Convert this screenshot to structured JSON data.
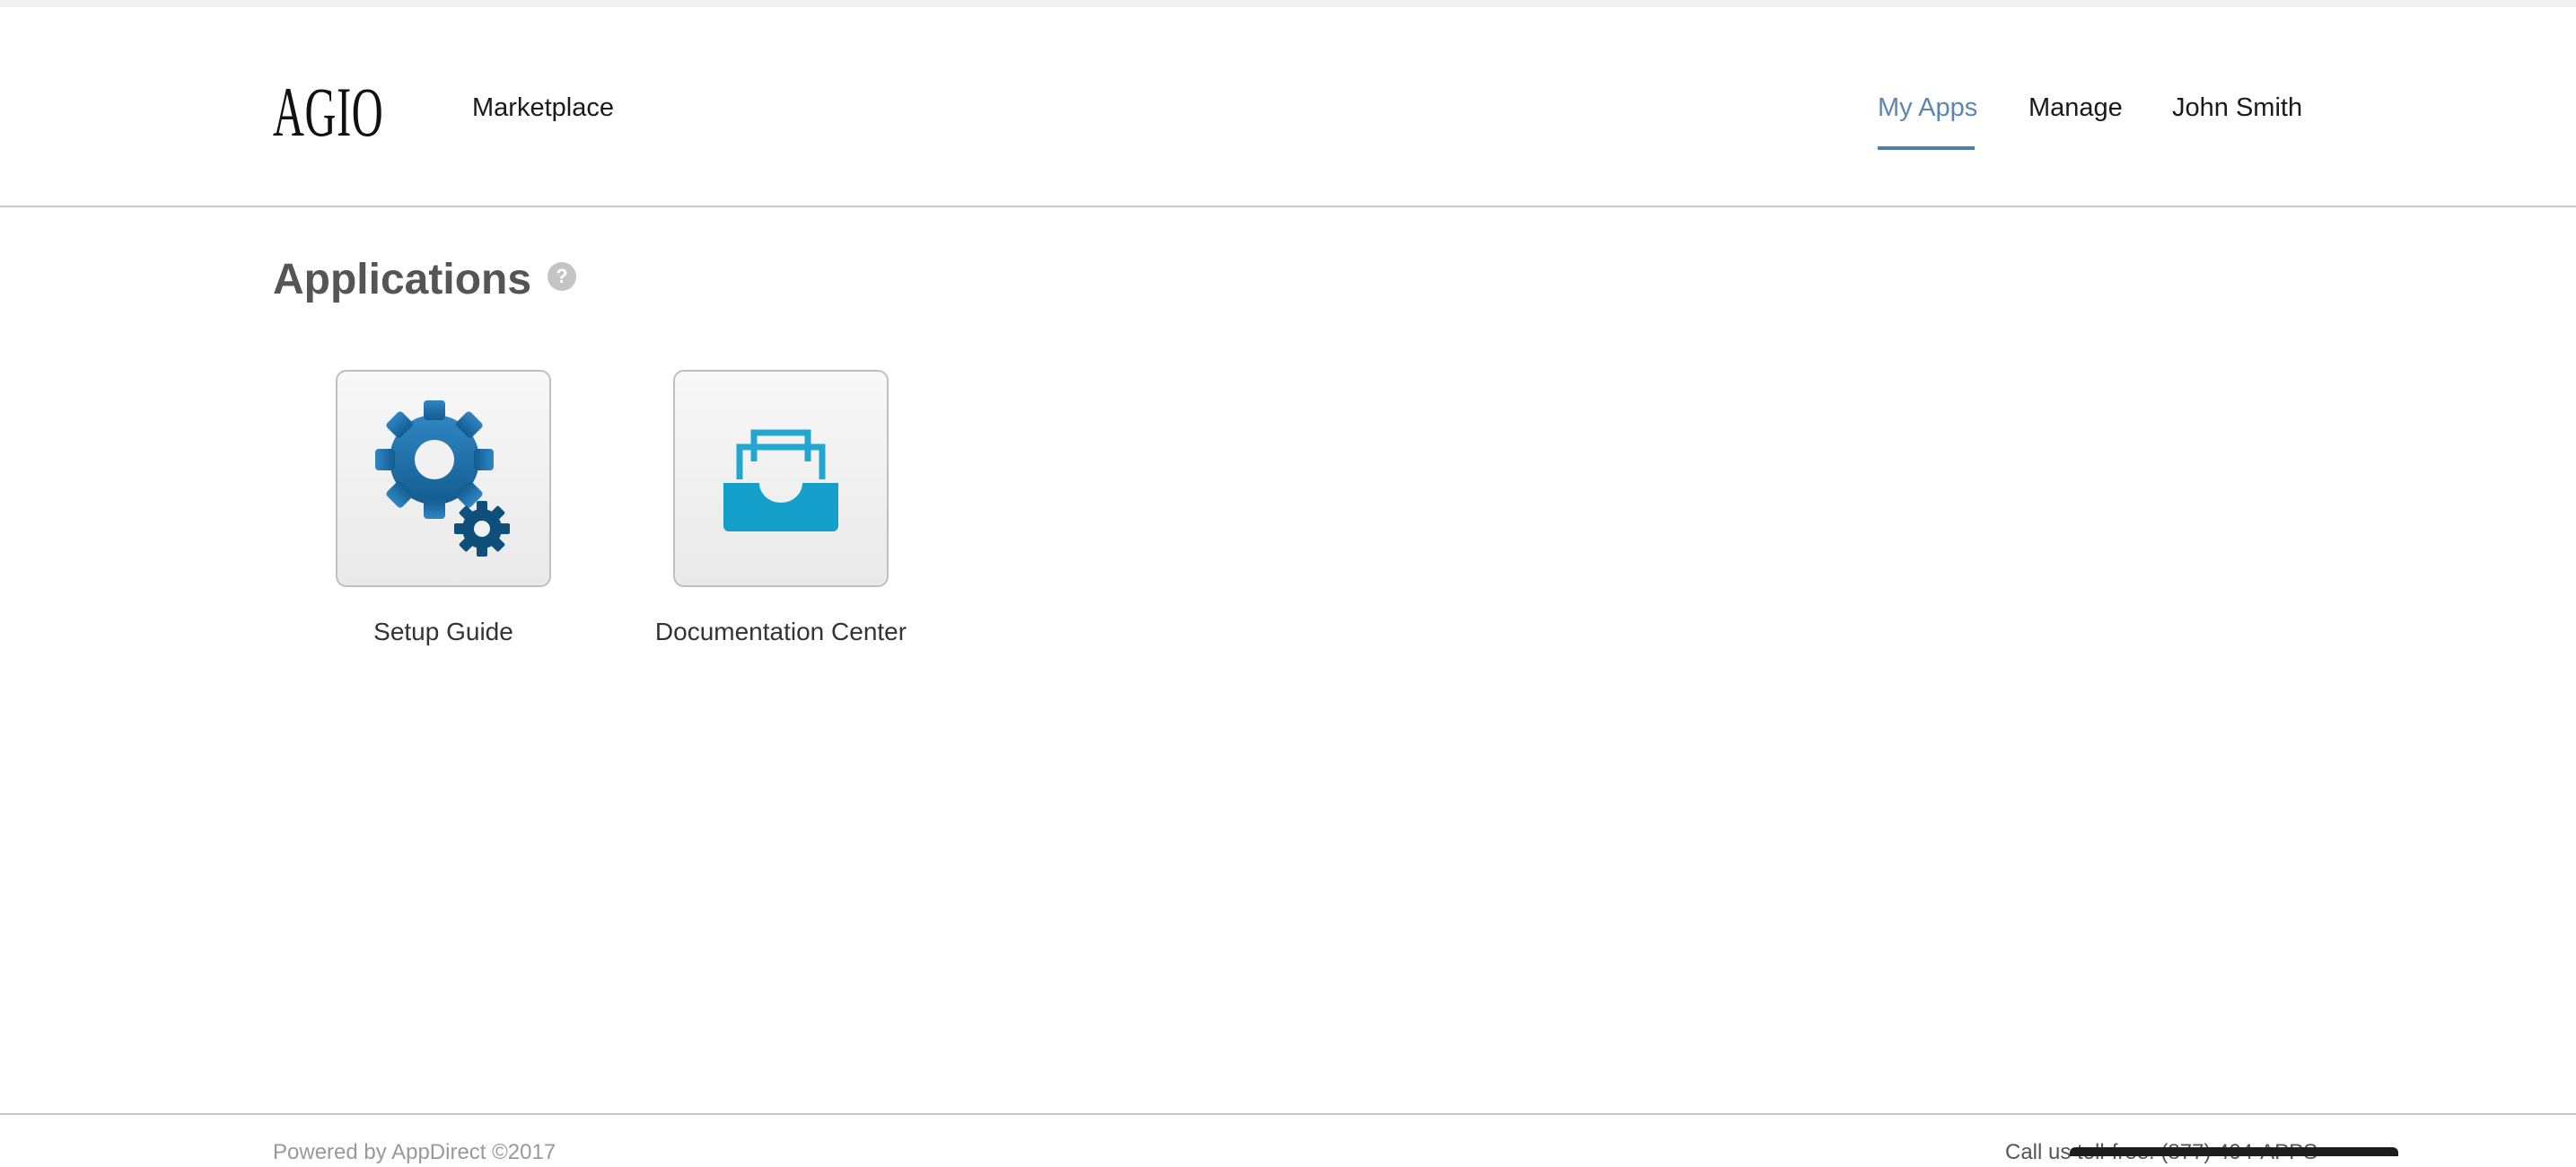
{
  "header": {
    "logo_text": "AGIO",
    "nav": {
      "marketplace": "Marketplace",
      "my_apps": "My Apps",
      "manage": "Manage",
      "user_name": "John Smith"
    },
    "active_color": "#5a86b3"
  },
  "main": {
    "title": "Applications",
    "help_glyph": "?",
    "apps": [
      {
        "label": "Setup Guide",
        "icon": "gears-icon",
        "color": "#1f6fa8"
      },
      {
        "label": "Documentation Center",
        "icon": "inbox-tray-icon",
        "color": "#1aa3c9"
      }
    ]
  },
  "footer": {
    "left_text": "Powered by AppDirect ©2017",
    "right_text": "Call us toll-free: (877) 404-APPS"
  }
}
